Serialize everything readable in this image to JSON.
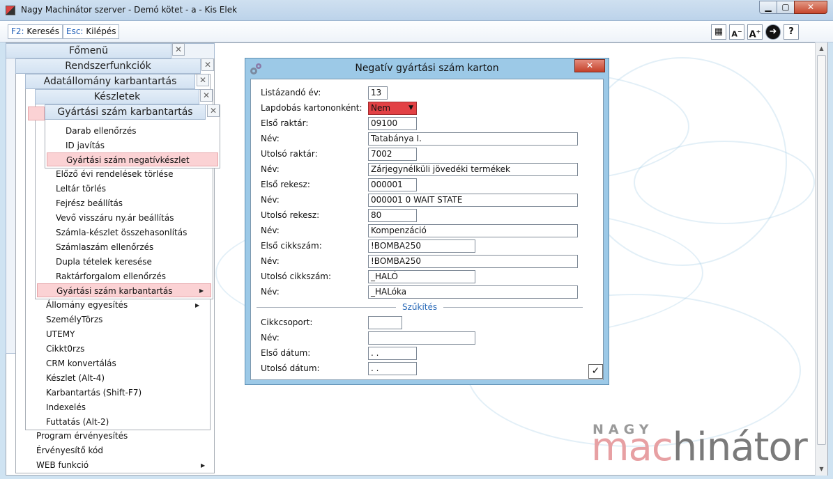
{
  "window": {
    "title": "Nagy Machinátor szerver - Demó kötet - a - Kis Elek",
    "min": "▁",
    "max": "▢",
    "close": "✕"
  },
  "toolbar": {
    "search_key": "F2:",
    "search_label": "Keresés",
    "exit_key": "Esc:",
    "exit_label": "Kilépés",
    "icons": {
      "grid": "▦",
      "font_down": "A",
      "font_up": "A",
      "nav": "➜",
      "help": "?"
    }
  },
  "menus": {
    "main_title": "Főmenü",
    "sys_title": "Rendszerfunkciók",
    "data_title": "Adatállomány karbantartás",
    "stock_title": "Készletek",
    "serial_title": "Gyártási szám karbantartás",
    "close_glyph": "✕",
    "serial_items": [
      "Darab ellenőrzés",
      "ID javítás",
      "Gyártási szám negatívkészlet"
    ],
    "stock_items": [
      "Előző évi rendelések törlése",
      "Leltár törlés",
      "Fejrész beállítás",
      "Vevő visszáru ny.ár beállítás",
      "Számla-készlet összehasonlítás",
      "Számlaszám ellenőrzés",
      "Dupla tételek keresése",
      "Raktárforgalom ellenőrzés",
      "Gyártási szám karbantartás"
    ],
    "data_items": [
      "Állomány egyesítés",
      "SzemélyTörzs",
      "UTEMY",
      "Cikkt0rzs",
      "CRM konvertálás",
      "Készlet (Alt-4)",
      "Karbantartás (Shift-F7)",
      "Indexelés",
      "Futtatás (Alt-2)"
    ],
    "sys_items": [
      "Program érvényesítés",
      "Érvényesítő kód",
      "WEB funkció"
    ]
  },
  "dialog": {
    "title": "Negatív gyártási szám karton",
    "close_glyph": "✕",
    "fields": [
      {
        "label": "Listázandó év:",
        "value": "13"
      },
      {
        "label": "Lapdobás kartononként:",
        "value": "Nem"
      },
      {
        "label": "Első raktár:",
        "value": "09100"
      },
      {
        "label": "Név:",
        "value": "Tatabánya I."
      },
      {
        "label": "Utolsó raktár:",
        "value": "7002"
      },
      {
        "label": "Név:",
        "value": "Zárjegynélküli jövedéki termékek"
      },
      {
        "label": "Első rekesz:",
        "value": "000001"
      },
      {
        "label": "Név:",
        "value": "000001 0 WAIT STATE"
      },
      {
        "label": "Utolsó rekesz:",
        "value": "80"
      },
      {
        "label": "Név:",
        "value": "Kompenzáció"
      },
      {
        "label": "Első cikkszám:",
        "value": "!BOMBA250"
      },
      {
        "label": "Név:",
        "value": "!BOMBA250"
      },
      {
        "label": "Utolsó cikkszám:",
        "value": "_HALÓ"
      },
      {
        "label": "Név:",
        "value": "_HALóka"
      }
    ],
    "section_title": "Szűkítés",
    "filter_fields": [
      {
        "label": "Cikkcsoport:",
        "value": ""
      },
      {
        "label": "Név:",
        "value": ""
      },
      {
        "label": "Első dátum:",
        "value": " .  ."
      },
      {
        "label": "Utolsó dátum:",
        "value": " .  ."
      }
    ],
    "ok_glyph": "✓"
  },
  "logo": {
    "top": "NAGY",
    "part1": "mac",
    "part2": "hinátor"
  },
  "colors": {
    "accent_red": "#e24145",
    "highlight": "#fbd2d4",
    "dialog_frame": "#9cc9e7"
  }
}
